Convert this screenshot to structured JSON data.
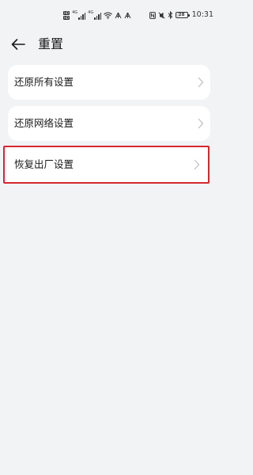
{
  "status_bar": {
    "sim1": "HD",
    "sim2": "HD",
    "net1": "4G",
    "net2": "4G",
    "icons": [
      "wifi-icon",
      "hotspot-icon",
      "nfc-icon",
      "silent-icon",
      "bluetooth-icon"
    ],
    "battery_level": "28",
    "battery_fraction": 0.28,
    "time": "10:31"
  },
  "header": {
    "back_icon": "arrow-left-icon",
    "title": "重置"
  },
  "items": [
    {
      "label": "还原所有设置",
      "icon": "chevron-right-icon"
    },
    {
      "label": "还原网络设置",
      "icon": "chevron-right-icon"
    },
    {
      "label": "恢复出厂设置",
      "icon": "chevron-right-icon",
      "highlighted": true
    }
  ],
  "colors": {
    "background": "#f1f3f5",
    "card": "#ffffff",
    "highlight_border": "#d6262f",
    "chevron": "#c2c2c2"
  }
}
